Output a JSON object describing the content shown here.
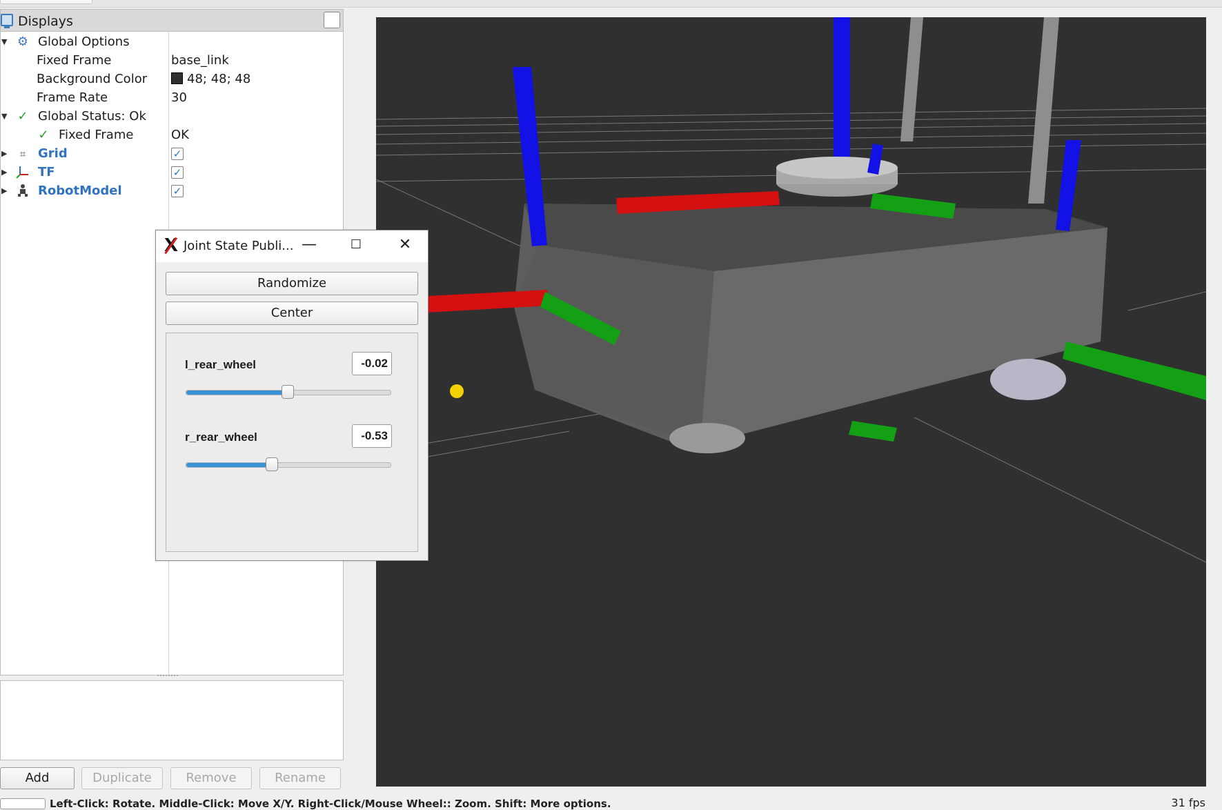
{
  "displays": {
    "title": "Displays",
    "global_options": {
      "label": "Global Options",
      "fixed_frame_label": "Fixed Frame",
      "fixed_frame_value": "base_link",
      "background_color_label": "Background Color",
      "background_color_value": "48; 48; 48",
      "background_color_hex": "#303030",
      "frame_rate_label": "Frame Rate",
      "frame_rate_value": "30"
    },
    "global_status": {
      "label": "Global Status: Ok",
      "fixed_frame_label": "Fixed Frame",
      "fixed_frame_value": "OK"
    },
    "items": [
      {
        "label": "Grid",
        "icon": "grid-icon",
        "checked": true
      },
      {
        "label": "TF",
        "icon": "tf-axes-icon",
        "checked": true
      },
      {
        "label": "RobotModel",
        "icon": "robot-model-icon",
        "checked": true
      }
    ]
  },
  "panel_buttons": {
    "add": "Add",
    "duplicate": "Duplicate",
    "remove": "Remove",
    "rename": "Rename"
  },
  "joint_state_publisher": {
    "title": "Joint State Publi...",
    "randomize": "Randomize",
    "center": "Center",
    "joints": [
      {
        "name": "l_rear_wheel",
        "value": "-0.02",
        "slider_fraction": 0.496
      },
      {
        "name": "r_rear_wheel",
        "value": "-0.53",
        "slider_fraction": 0.418
      }
    ]
  },
  "viewport": {
    "background_color": "#303030",
    "axis_colors": {
      "x": "#d41010",
      "y": "#14a014",
      "z": "#1010e0"
    }
  },
  "status_bar": {
    "hint": "Left-Click: Rotate.  Middle-Click: Move X/Y.  Right-Click/Mouse Wheel:: Zoom.  Shift: More options.",
    "fps": "31 fps"
  },
  "colors": {
    "accent": "#2f73c2",
    "ok_green": "#2a9d2a",
    "slider_fill": "#3a92d6"
  }
}
